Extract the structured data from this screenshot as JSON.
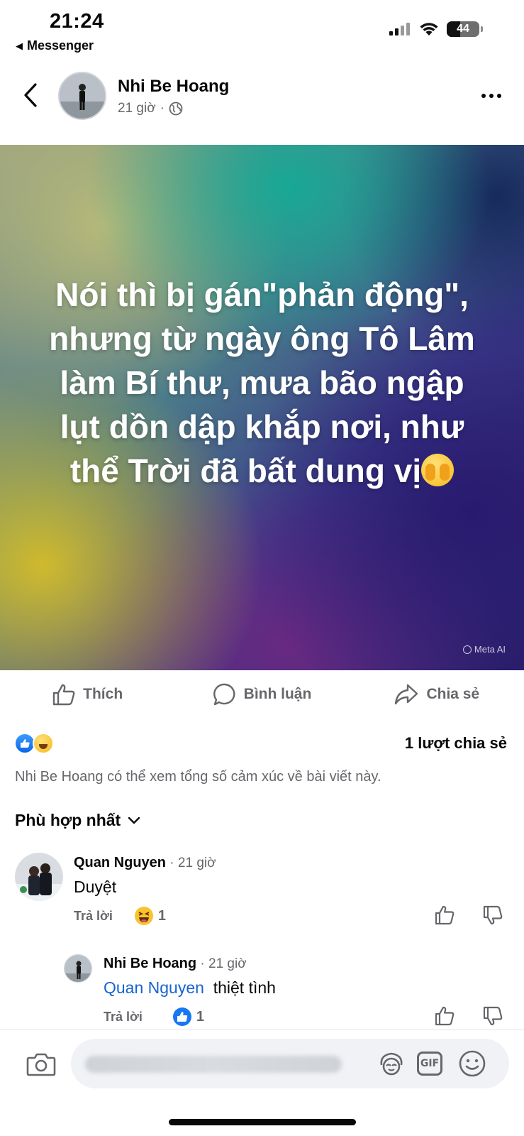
{
  "status_bar": {
    "time": "21:24",
    "back_app": "Messenger",
    "battery": "44"
  },
  "post": {
    "author": "Nhi Be Hoang",
    "time": "21 giờ",
    "separator": "·",
    "privacy_icon": "globe-icon",
    "text": "Nói thì bị gán\"phản động\", nhưng từ ngày ông Tô Lâm làm Bí thư, mưa bão ngập lụt dồn dập khắp nơi, như thể Trời đã bất dung vị",
    "text_emoji": "face-with-open-eyes-and-hand-over-mouth",
    "watermark": "Meta AI"
  },
  "actions": {
    "like": "Thích",
    "comment": "Bình luận",
    "share": "Chia sẻ"
  },
  "reactions": {
    "icons": [
      "like",
      "haha"
    ],
    "share_count": "1 lượt chia sẻ",
    "visibility_note": "Nhi Be Hoang có thể xem tổng số cảm xúc về bài viết này."
  },
  "sort": {
    "label": "Phù hợp nhất"
  },
  "comments": [
    {
      "author": "Quan Nguyen",
      "time": "· 21 giờ",
      "text": "Duyệt",
      "reply_label": "Trả lời",
      "reaction": "haha",
      "reaction_count": "1"
    },
    {
      "author": "Nhi Be Hoang",
      "time": "· 21 giờ",
      "mention": "Quan Nguyen",
      "text": "thiệt tình",
      "reply_label": "Trả lời",
      "reaction": "like",
      "reaction_count": "1"
    }
  ],
  "composer": {
    "placeholder": ""
  },
  "colors": {
    "brand_blue": "#0866FF",
    "mention_blue": "#1763CF",
    "secondary_text": "#65676B"
  }
}
